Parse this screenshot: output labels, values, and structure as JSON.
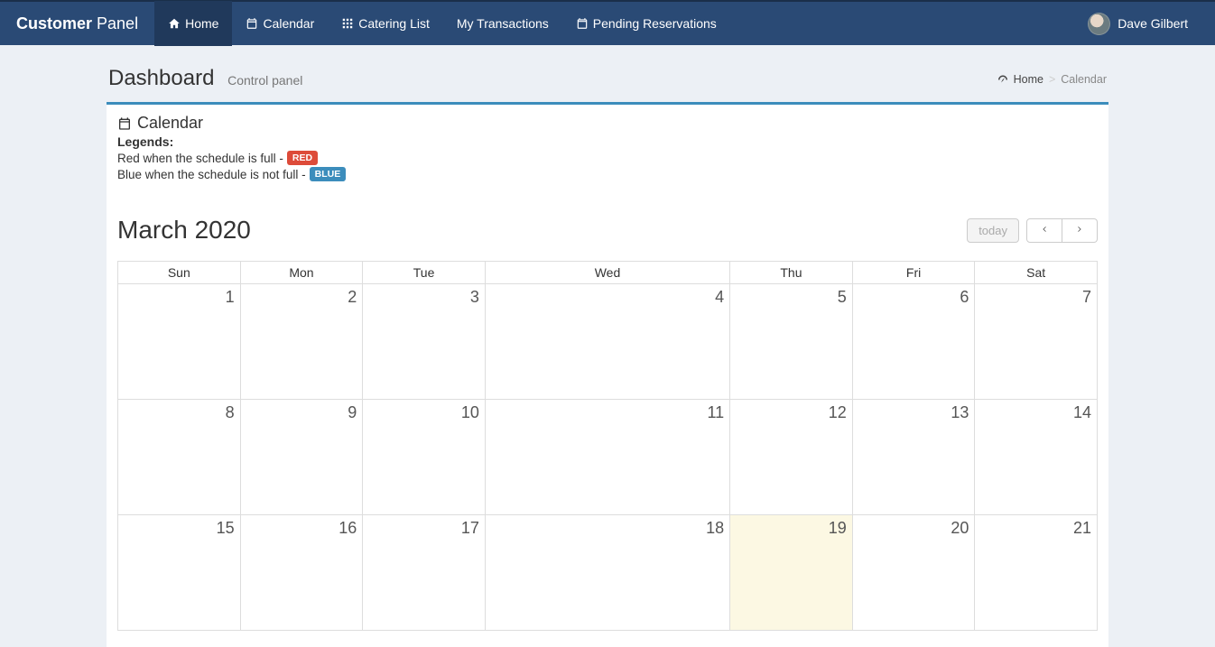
{
  "brand": {
    "bold": "Customer",
    "light": "Panel"
  },
  "nav": {
    "home": "Home",
    "calendar": "Calendar",
    "catering_list": "Catering List",
    "my_transactions": "My Transactions",
    "pending_reservations": "Pending Reservations"
  },
  "user": {
    "name": "Dave Gilbert"
  },
  "page": {
    "title": "Dashboard",
    "subtitle": "Control panel"
  },
  "breadcrumb": {
    "home": "Home",
    "current": "Calendar"
  },
  "panel": {
    "title": "Calendar",
    "legends_label": "Legends:",
    "legend_red_text": "Red when the schedule is full -",
    "legend_red_badge": "RED",
    "legend_blue_text": "Blue when the schedule is not full -",
    "legend_blue_badge": "BLUE"
  },
  "calendar": {
    "month_title": "March 2020",
    "today_label": "today",
    "day_headers": [
      "Sun",
      "Mon",
      "Tue",
      "Wed",
      "Thu",
      "Fri",
      "Sat"
    ],
    "weeks": [
      [
        "1",
        "2",
        "3",
        "4",
        "5",
        "6",
        "7"
      ],
      [
        "8",
        "9",
        "10",
        "11",
        "12",
        "13",
        "14"
      ],
      [
        "15",
        "16",
        "17",
        "18",
        "19",
        "20",
        "21"
      ]
    ],
    "today_cell": "19"
  }
}
